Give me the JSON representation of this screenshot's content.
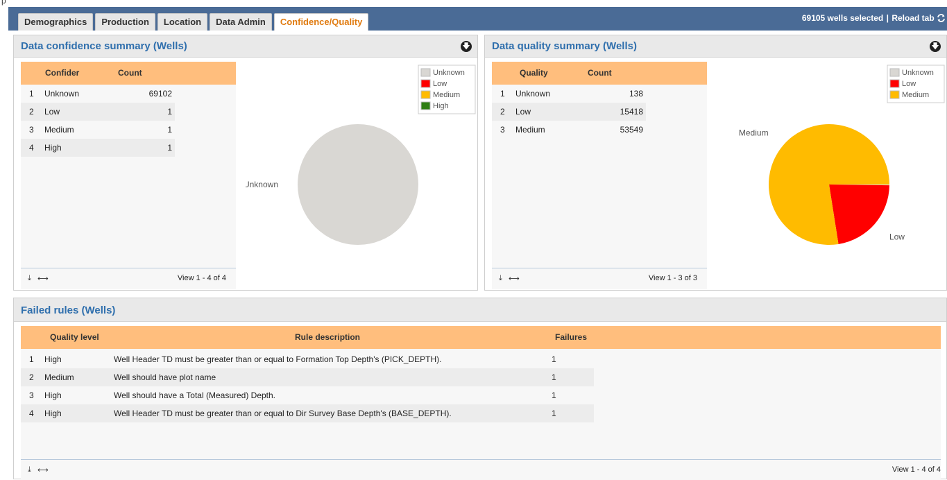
{
  "top_strip_label": "p",
  "tabs": [
    {
      "label": "Demographics",
      "active": false
    },
    {
      "label": "Production",
      "active": false
    },
    {
      "label": "Location",
      "active": false
    },
    {
      "label": "Data Admin",
      "active": false
    },
    {
      "label": "Confidence/Quality",
      "active": true
    }
  ],
  "tab_info": {
    "selected": "69105 wells selected",
    "separator": "|",
    "reload": "Reload tab",
    "reload_icon": "refresh-icon"
  },
  "confidence_panel": {
    "title": "Data confidence summary (Wells)",
    "download_icon": "download-circle-icon",
    "columns": [
      "Confider",
      "Count"
    ],
    "rows": [
      {
        "n": "1",
        "level": "Unknown",
        "count": "69102"
      },
      {
        "n": "2",
        "level": "Low",
        "count": "1"
      },
      {
        "n": "3",
        "level": "Medium",
        "count": "1"
      },
      {
        "n": "4",
        "level": "High",
        "count": "1"
      }
    ],
    "pager": "View 1 - 4 of 4"
  },
  "quality_panel": {
    "title": "Data quality summary (Wells)",
    "download_icon": "download-circle-icon",
    "columns": [
      "Quality",
      "Count"
    ],
    "rows": [
      {
        "n": "1",
        "level": "Unknown",
        "count": "138"
      },
      {
        "n": "2",
        "level": "Low",
        "count": "15418"
      },
      {
        "n": "3",
        "level": "Medium",
        "count": "53549"
      }
    ],
    "pager": "View 1 - 3 of 3"
  },
  "failed_panel": {
    "title": "Failed rules (Wells)",
    "columns": [
      "Quality level",
      "Rule description",
      "Failures"
    ],
    "rows": [
      {
        "n": "1",
        "level": "High",
        "desc": "Well Header TD must be greater than or equal to Formation Top Depth's (PICK_DEPTH).",
        "failures": "1"
      },
      {
        "n": "2",
        "level": "Medium",
        "desc": "Well should have plot name",
        "failures": "1"
      },
      {
        "n": "3",
        "level": "High",
        "desc": "Well should have a Total (Measured) Depth.",
        "failures": "1"
      },
      {
        "n": "4",
        "level": "High",
        "desc": "Well Header TD must be greater than or equal to Dir Survey Base Depth's (BASE_DEPTH).",
        "failures": "1"
      }
    ],
    "pager": "View 1 - 4 of 4"
  },
  "footer_icons": {
    "export": "export-icon",
    "resize": "resize-columns-icon"
  },
  "chart_data": [
    {
      "type": "pie",
      "title": "",
      "categories": [
        "Unknown",
        "Low",
        "Medium",
        "High"
      ],
      "values": [
        69102,
        1,
        1,
        1
      ],
      "colors": [
        "#d9d7d3",
        "#ff0000",
        "#ffbb00",
        "#2e7d12"
      ],
      "slice_labels": [
        "Unknown"
      ],
      "legend": "top-right"
    },
    {
      "type": "pie",
      "title": "",
      "categories": [
        "Unknown",
        "Low",
        "Medium"
      ],
      "values": [
        138,
        15418,
        53549
      ],
      "colors": [
        "#d9d7d3",
        "#ff0000",
        "#ffbb00"
      ],
      "slice_labels": [
        "Low",
        "Medium"
      ],
      "legend": "top-right"
    }
  ]
}
